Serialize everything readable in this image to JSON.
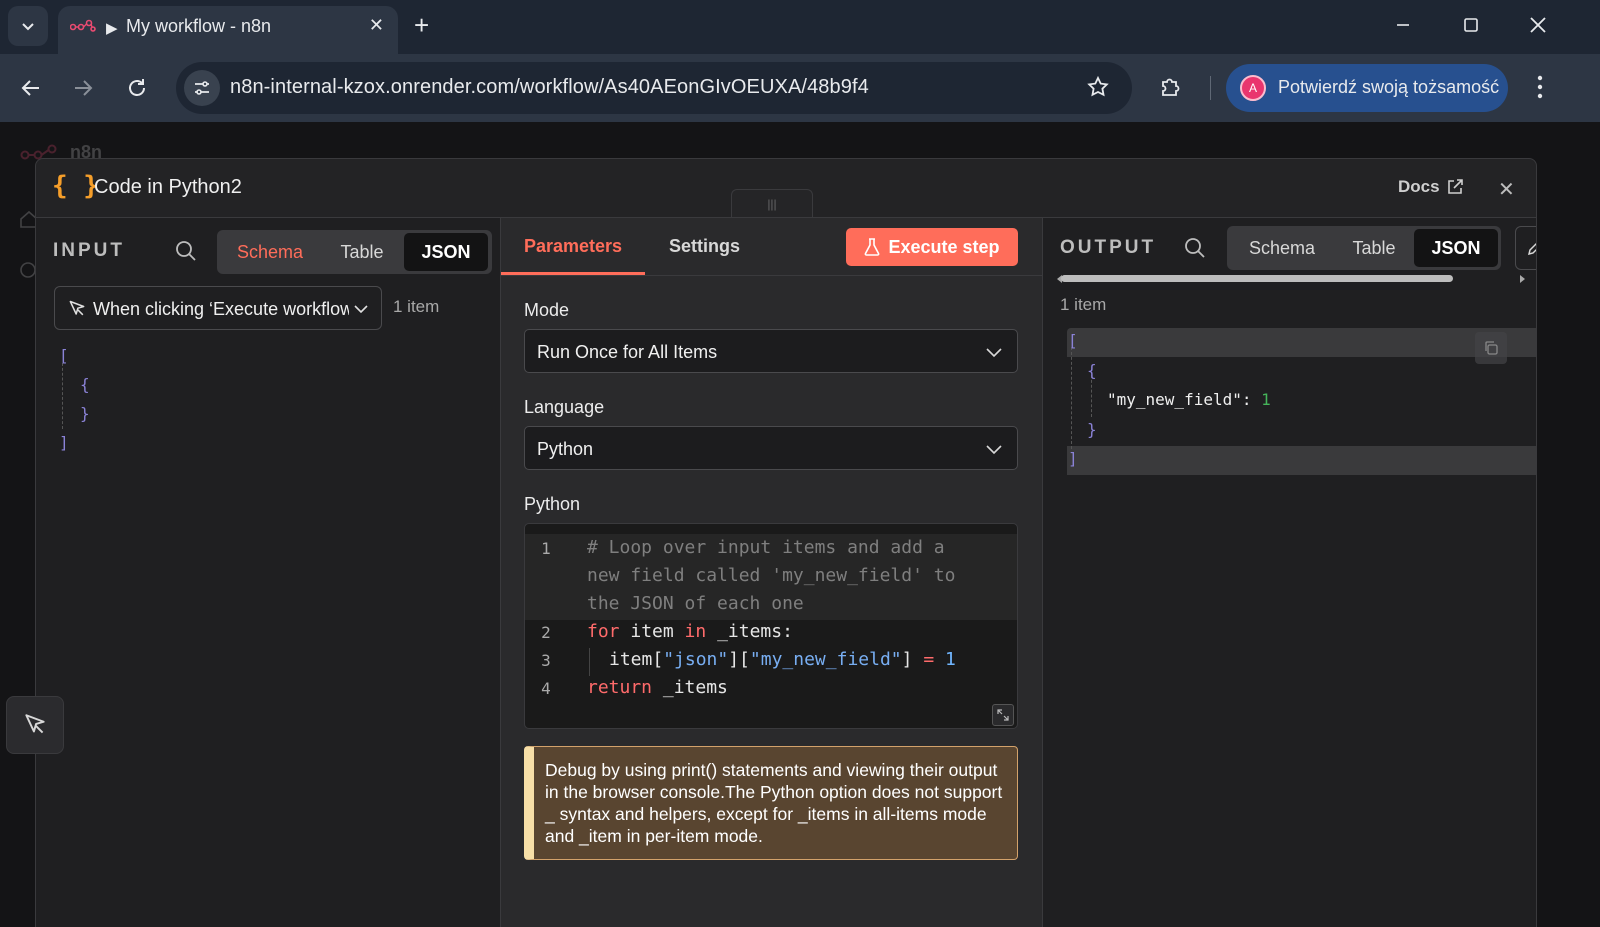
{
  "browser": {
    "tab_title": "My workflow - n8n",
    "url": "n8n-internal-kzox.onrender.com/workflow/As40AEonGIvOEUXA/48b9f4",
    "profile_label": "Potwierdź swoją tożsamość",
    "profile_initial": "A",
    "icons": [
      "tab-menu-icon",
      "n8n-favicon",
      "play-icon",
      "close-icon",
      "plus-icon",
      "minimize-icon",
      "maximize-icon",
      "back-icon",
      "forward-icon",
      "reload-icon",
      "site-info-icon",
      "star-icon",
      "extensions-icon",
      "kebab-icon"
    ]
  },
  "background": {
    "app_name": "n8n"
  },
  "modal": {
    "node_icon": "{ }",
    "node_title": "Code in Python2",
    "docs_label": "Docs",
    "drag_handle": "|||"
  },
  "input_panel": {
    "label": "INPUT",
    "tabs": [
      "Schema",
      "Table",
      "JSON"
    ],
    "active_tab": "JSON",
    "trigger_select": "When clicking ‘Execute workflow’",
    "item_count": "1 item",
    "json_lines": [
      "[",
      "{",
      "}",
      "]"
    ]
  },
  "params_panel": {
    "tabs": [
      "Parameters",
      "Settings"
    ],
    "active_tab": "Parameters",
    "execute_label": "Execute step",
    "mode_label": "Mode",
    "mode_value": "Run Once for All Items",
    "language_label": "Language",
    "language_value": "Python",
    "code_label": "Python",
    "code": {
      "line_numbers": [
        "1",
        "2",
        "3",
        "4"
      ],
      "comment_lines": [
        "# Loop over input items and add a",
        "new field called 'my_new_field' to",
        "the JSON of each one"
      ],
      "line2": {
        "kw1": "for",
        "a": " item ",
        "kw2": "in",
        "b": " _items:"
      },
      "line3": {
        "a": "item[",
        "s1": "\"json\"",
        "b": "][",
        "s2": "\"my_new_field\"",
        "c": "] ",
        "op": "=",
        "d": " ",
        "n": "1"
      },
      "line4": {
        "kw": "return",
        "a": " _items"
      }
    },
    "notice": "Debug by using print() statements and viewing their output in the browser console.The Python option does not support _ syntax and helpers, except for _items in all-items mode and _item in per-item mode."
  },
  "output_panel": {
    "label": "OUTPUT",
    "tabs": [
      "Schema",
      "Table",
      "JSON"
    ],
    "active_tab": "JSON",
    "item_count": "1 item",
    "json": {
      "open_bracket": "[",
      "open_brace": "{",
      "key": "\"my_new_field\"",
      "colon": ":",
      "value": "1",
      "close_brace": "}",
      "close_bracket": "]"
    }
  },
  "colors": {
    "accent": "#ff6d5a",
    "code_icon": "#f59e2a",
    "bracket": "#8a82d6",
    "number_value": "#45b45a"
  }
}
